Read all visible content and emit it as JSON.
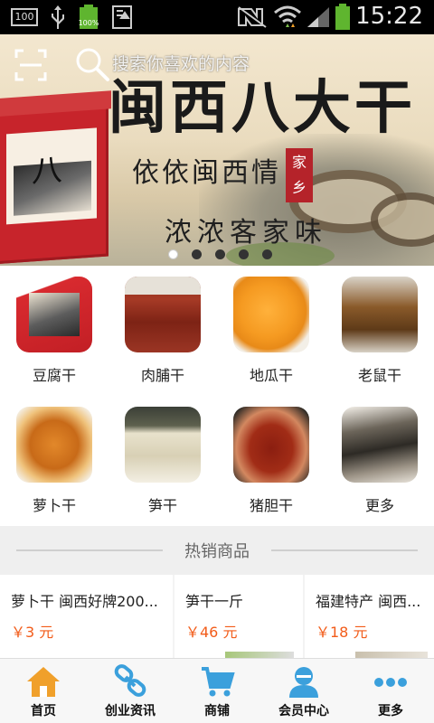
{
  "status_bar": {
    "time": "15:22",
    "badge_100": "100",
    "battery_small_pct": "100%",
    "icons": [
      "box-100-icon",
      "usb-icon",
      "battery-icon",
      "download-icon",
      "nfc-off-icon",
      "wifi-icon",
      "signal-icon",
      "battery-full-icon"
    ]
  },
  "search": {
    "placeholder": "搜索你喜欢的内容"
  },
  "banner": {
    "title": "闽西八大干",
    "line1": "依依闽西情",
    "line2": "浓浓客家味",
    "seal": "家乡",
    "slide_count": 5,
    "active_slide": 0
  },
  "categories": [
    {
      "label": "豆腐干",
      "icon": "tofu-thumb"
    },
    {
      "label": "肉脯干",
      "icon": "jerky-thumb"
    },
    {
      "label": "地瓜干",
      "icon": "sweet-potato-thumb"
    },
    {
      "label": "老鼠干",
      "icon": "rat-jerky-thumb"
    },
    {
      "label": "萝卜干",
      "icon": "radish-thumb"
    },
    {
      "label": "笋干",
      "icon": "bamboo-shoot-thumb"
    },
    {
      "label": "猪胆干",
      "icon": "pig-gallbladder-thumb"
    },
    {
      "label": "更多",
      "icon": "more-thumb"
    }
  ],
  "hot": {
    "title": "热销商品"
  },
  "products": [
    {
      "name": "萝卜干 闽西好牌200...",
      "price": "￥3 元"
    },
    {
      "name": "笋干一斤",
      "price": "￥46 元"
    },
    {
      "name": "福建特产 闽西...",
      "price": "￥18 元"
    }
  ],
  "nav": [
    {
      "label": "首页",
      "icon": "home-icon"
    },
    {
      "label": "创业资讯",
      "icon": "link-icon"
    },
    {
      "label": "商铺",
      "icon": "cart-icon"
    },
    {
      "label": "会员中心",
      "icon": "user-icon"
    },
    {
      "label": "更多",
      "icon": "more-dots-icon"
    }
  ],
  "colors": {
    "price": "#f25c1a",
    "nav_icon": "#3ba0dc",
    "home_icon": "#f0a02b"
  }
}
